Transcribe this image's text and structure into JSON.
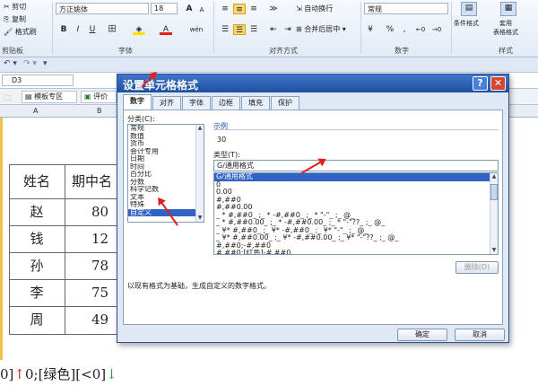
{
  "ribbon": {
    "clipboard": {
      "cut": "剪切",
      "copy": "复制",
      "format_painter": "格式刷",
      "group": "剪贴板"
    },
    "font": {
      "name": "方正姚体",
      "size": "18",
      "grow": "A",
      "shrink": "A",
      "bold": "B",
      "italic": "I",
      "underline": "U",
      "border": "田",
      "font_color": "A",
      "phonetic": "wén",
      "group": "字体"
    },
    "alignment": {
      "wrap": "自动换行",
      "merge": "合并后居中",
      "group": "对齐方式"
    },
    "number": {
      "format": "常规",
      "percent": "%",
      "comma": ",",
      "group": "数字"
    },
    "styles": {
      "conditional": "条件格式",
      "table": "套用\n表格格式",
      "group": "样式"
    }
  },
  "formula_bar": {
    "name_box": "D3"
  },
  "sheet_tabs": {
    "template": "模板专区",
    "review": "评价"
  },
  "columns": [
    "A",
    "B"
  ],
  "sheet": {
    "header": {
      "name": "姓名",
      "midterm": "期中名"
    },
    "rows": [
      {
        "name": "赵",
        "score": "80"
      },
      {
        "name": "钱",
        "score": "12"
      },
      {
        "name": "孙",
        "score": "78"
      },
      {
        "name": "李",
        "score": "75"
      },
      {
        "name": "周",
        "score": "49"
      }
    ]
  },
  "bottom_text": {
    "prefix": "0]",
    "up": "↑",
    "rest": "0;[绿色][<0]",
    "down": "↓"
  },
  "dialog": {
    "title": "设置单元格格式",
    "help": "?",
    "close": "✕",
    "tabs": [
      "数字",
      "对齐",
      "字体",
      "边框",
      "填充",
      "保护"
    ],
    "category_label": "分类(C):",
    "categories": [
      "常规",
      "数值",
      "货币",
      "会计专用",
      "日期",
      "时间",
      "百分比",
      "分数",
      "科学记数",
      "文本",
      "特殊",
      "自定义"
    ],
    "selected_category": "自定义",
    "sample_label": "示例",
    "sample_value": "30",
    "type_label": "类型(T):",
    "type_value": "G/通用格式",
    "types": [
      "G/通用格式",
      "0",
      "0.00",
      "#,##0",
      "#,##0.00",
      "_ * #,##0_ ;_ * -#,##0_ ;_ * \"-\"_ ;_ @_",
      "_ * #,##0.00_ ;_ * -#,##0.00_ ;_ * \"-\"??_ ;_ @_",
      "_ ¥* #,##0_ ;_ ¥* -#,##0_ ;_ ¥* \"-\"_ ;_ @_",
      "_ ¥* #,##0.00_ ;_ ¥* -#,##0.00_ ;_ ¥* \"-\"??_ ;_ @_",
      "#,##0;-#,##0",
      "#,##0;[红色]-#,##0"
    ],
    "selected_type": "G/通用格式",
    "delete_label": "删除(D)",
    "description": "以现有格式为基础，生成自定义的数字格式。",
    "ok_label": "确定",
    "cancel_label": "取消"
  },
  "colors": {
    "accent": "#e0201c",
    "title_bar": "#1f4f9e",
    "selection": "#3163c5"
  }
}
